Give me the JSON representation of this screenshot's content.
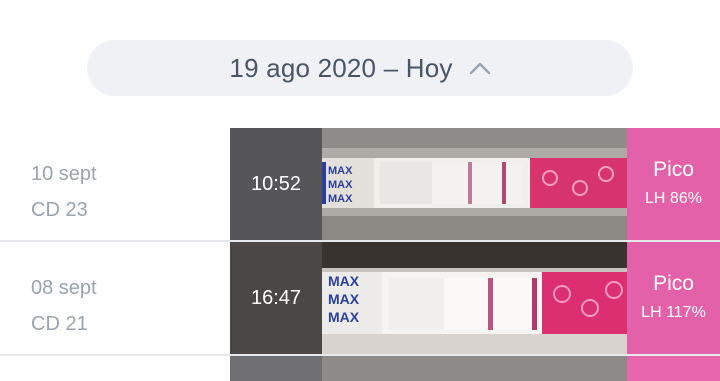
{
  "header": {
    "date_range": "19 ago 2020 – Hoy",
    "toggle_icon": "chevron-up-icon"
  },
  "tests": [
    {
      "date": "10 sept",
      "cycle_day": "CD 23",
      "time": "10:52",
      "level": "Pico",
      "lh": "LH 86%",
      "strip_label": "MAX"
    },
    {
      "date": "08 sept",
      "cycle_day": "CD 21",
      "time": "16:47",
      "level": "Pico",
      "lh": "LH 117%",
      "strip_label": "MAX"
    }
  ],
  "colors": {
    "peak": "#e361a8",
    "time_bg": "#565659",
    "muted_text": "#9aa3b0",
    "pill_bg": "#eff1f5"
  }
}
